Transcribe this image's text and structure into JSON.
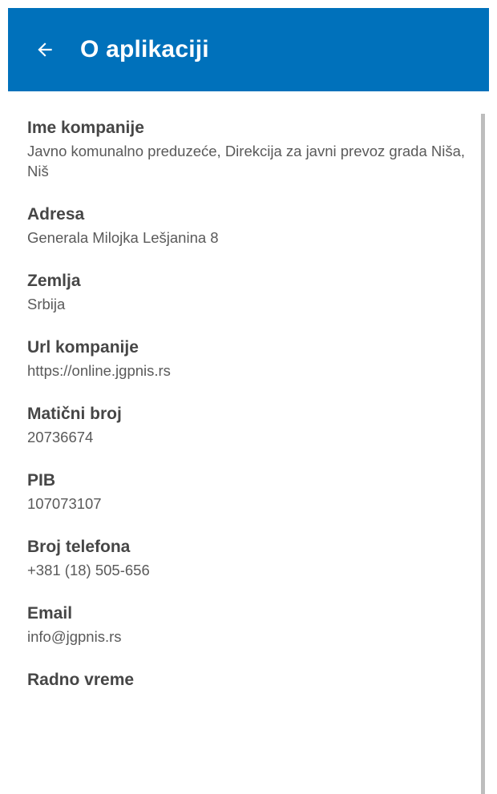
{
  "app_bar": {
    "title": "O aplikaciji",
    "back_icon": "arrow-back-icon",
    "background_color": "#0071bb"
  },
  "fields": [
    {
      "label": "Ime kompanije",
      "value": "Javno komunalno preduzeće, Direkcija za javni prevoz grada Niša, Niš"
    },
    {
      "label": "Adresa",
      "value": "Generala Milojka Lešjanina 8"
    },
    {
      "label": "Zemlja",
      "value": "Srbija"
    },
    {
      "label": "Url kompanije",
      "value": "https://online.jgpnis.rs"
    },
    {
      "label": "Matični broj",
      "value": "20736674"
    },
    {
      "label": "PIB",
      "value": "107073107"
    },
    {
      "label": "Broj telefona",
      "value": "+381 (18) 505-656"
    },
    {
      "label": "Email",
      "value": "info@jgpnis.rs"
    },
    {
      "label": "Radno vreme",
      "value": ""
    }
  ]
}
